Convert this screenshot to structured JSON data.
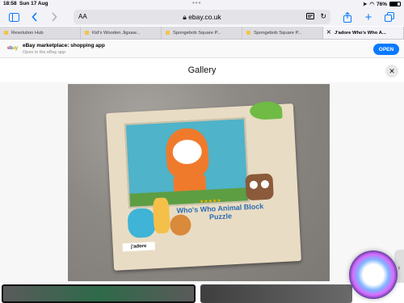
{
  "status_bar": {
    "time": "18:58",
    "date": "Sun 17 Aug",
    "battery_percent": "76%",
    "battery_level": 0.76
  },
  "toolbar": {
    "reader_size_label": "AA",
    "url_host": "ebay.co.uk"
  },
  "tabs": [
    {
      "label": "Resolution Hub"
    },
    {
      "label": "Kid's Wooden Jigsaw..."
    },
    {
      "label": "Spongebob Square P..."
    },
    {
      "label": "Spongebob Square P..."
    },
    {
      "label": "J'adore Who's Who A..."
    }
  ],
  "app_banner": {
    "logo": "ebay",
    "title": "eBay marketplace: shopping app",
    "subtitle": "Open in the eBay app",
    "open_label": "OPEN"
  },
  "gallery": {
    "title": "Gallery"
  },
  "product_image": {
    "box_text": "Who's Who Animal Block Puzzle",
    "stars": "★★★★★",
    "brand": "j'adore"
  },
  "colors": {
    "accent": "#0a7aff",
    "ebay_red": "#e53238",
    "ebay_blue": "#0064d2",
    "ebay_yellow": "#f5af02",
    "ebay_green": "#86b817"
  },
  "icons": {
    "sidebar": "sidebar-icon",
    "back": "chevron-left-icon",
    "forward": "chevron-right-icon",
    "share": "share-icon",
    "new_tab": "plus-icon",
    "tabs_overview": "tabs-icon",
    "reload": "reload-icon",
    "reader": "reader-icon",
    "close": "close-icon"
  }
}
